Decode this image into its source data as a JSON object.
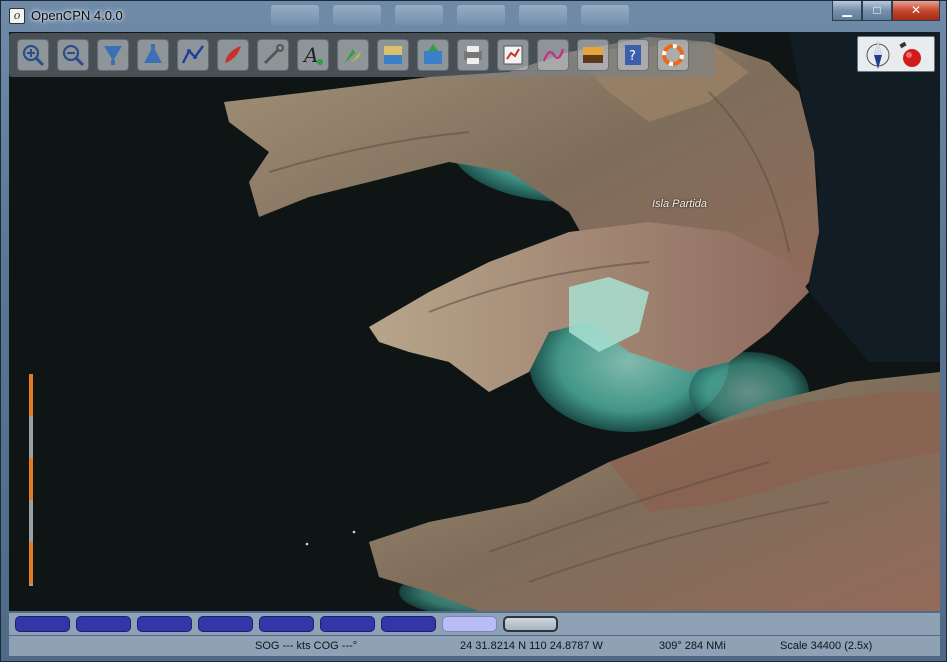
{
  "window": {
    "title": "OpenCPN 4.0.0",
    "controls": {
      "minimize": "▁",
      "maximize": "□",
      "close": "✕"
    }
  },
  "toolbar": {
    "tools": [
      {
        "name": "zoom-in-icon"
      },
      {
        "name": "zoom-out-icon"
      },
      {
        "name": "scale-in-icon"
      },
      {
        "name": "scale-out-icon"
      },
      {
        "name": "route-icon"
      },
      {
        "name": "auto-follow-icon"
      },
      {
        "name": "settings-icon"
      },
      {
        "name": "text-icon"
      },
      {
        "name": "current-icon"
      },
      {
        "name": "tides-icon"
      },
      {
        "name": "waypoint-icon"
      },
      {
        "name": "print-icon"
      },
      {
        "name": "route-manager-icon"
      },
      {
        "name": "track-icon"
      },
      {
        "name": "color-scheme-icon"
      },
      {
        "name": "help-icon"
      },
      {
        "name": "mob-icon"
      }
    ]
  },
  "map": {
    "place_label": "Isla Partida"
  },
  "chartbar": {
    "tiles": [
      "normal",
      "normal",
      "normal",
      "normal",
      "normal",
      "normal",
      "normal",
      "selected",
      "outline"
    ]
  },
  "status": {
    "sog_cog": "SOG --- kts  COG ---°",
    "position": "24 31.8214 N   110 24.8787 W",
    "bearing_distance": "309°  284 NMi",
    "scale": "Scale 34400 (2.5x)"
  },
  "colors": {
    "deep_water": "#0e1514",
    "shallow_water": "#5fc6b5",
    "land": "#8a7a66",
    "scale_bar_orange": "#e07b2a",
    "chart_tile": "#3236a6"
  }
}
